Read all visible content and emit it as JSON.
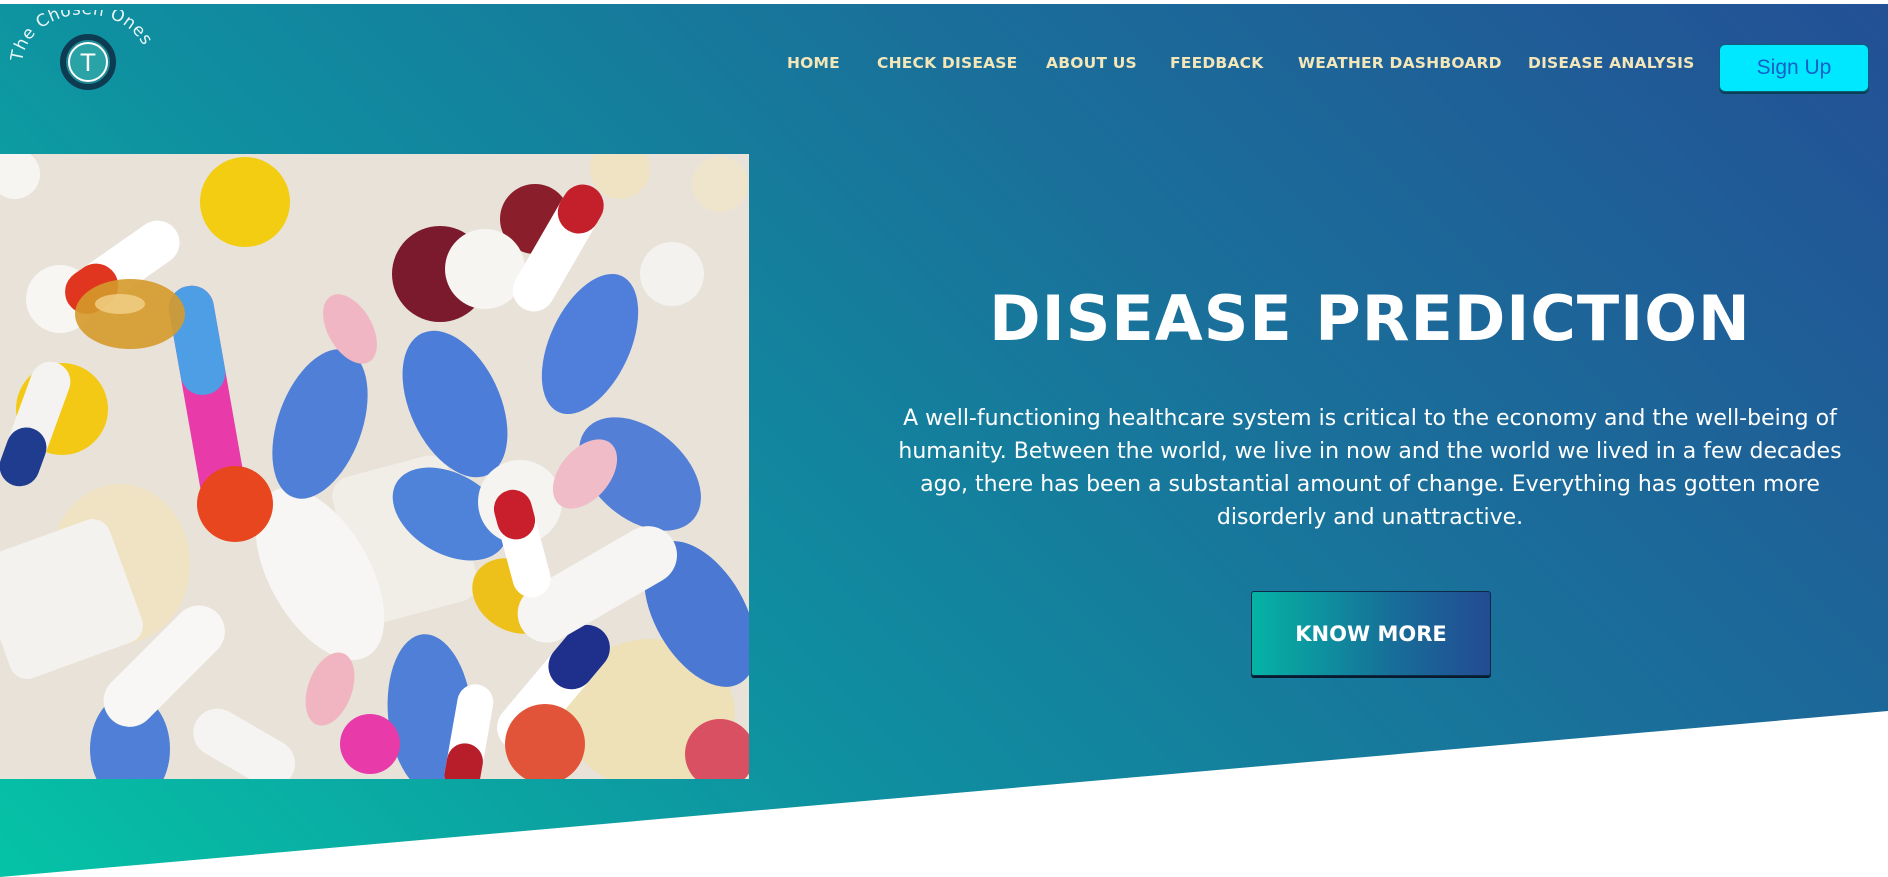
{
  "logo": {
    "arc_text": "The Chosen Ones",
    "letter": "T"
  },
  "nav": {
    "items": [
      {
        "label": "HOME"
      },
      {
        "label": "CHECK DISEASE"
      },
      {
        "label": "ABOUT US"
      },
      {
        "label": "FEEDBACK"
      },
      {
        "label": "WEATHER DASHBOARD"
      },
      {
        "label": "DISEASE ANALYSIS"
      }
    ],
    "signup_label": "Sign Up"
  },
  "hero": {
    "title": "DISEASE PREDICTION",
    "description": "A well-functioning healthcare system is critical to the economy and the well-being of humanity. Between the world, we live in now and the world we lived in a few decades ago, there has been a substantial amount of change. Everything has gotten more disorderly and unattractive.",
    "button_label": "KNOW MORE",
    "image": "colorful-pills-photo"
  },
  "colors": {
    "gradient_start": "#05c3a6",
    "gradient_end": "#235095",
    "nav_text": "#f3e6b8",
    "signup_bg": "#00e8ff",
    "signup_text": "#1560c8"
  }
}
